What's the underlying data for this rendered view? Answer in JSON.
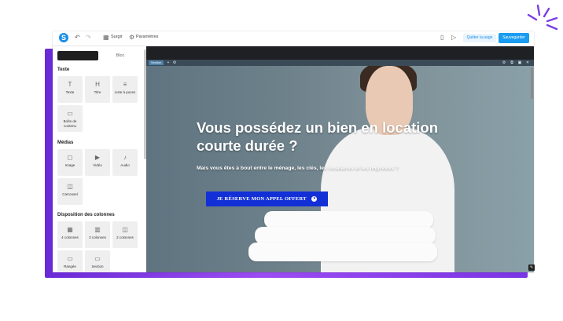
{
  "toolbar": {
    "undo_icon": "undo-icon",
    "redo_icon": "redo-icon",
    "surgir_label": "Surgir",
    "params_label": "Paramètres",
    "quit_label": "Quitter la page",
    "save_label": "Sauvegarder"
  },
  "sidebar": {
    "tab_blocks": "Bloc",
    "sections": {
      "text": "Texte",
      "media": "Médias",
      "columns": "Disposition des colonnes"
    },
    "text_items": [
      {
        "label": "Texte",
        "icon": "T"
      },
      {
        "label": "Titre",
        "icon": "H"
      },
      {
        "label": "Liste à puces",
        "icon": "≡"
      },
      {
        "label": "Boîte de contenu",
        "icon": "▭"
      }
    ],
    "media_items": [
      {
        "label": "Image",
        "icon": "◻"
      },
      {
        "label": "Vidéo",
        "icon": "▶"
      },
      {
        "label": "Audio",
        "icon": "♪"
      },
      {
        "label": "Carrousel",
        "icon": "◫"
      }
    ],
    "column_items": [
      {
        "label": "4 colonnes",
        "icon": "▦"
      },
      {
        "label": "3 colonnes",
        "icon": "▥"
      },
      {
        "label": "2 colonnes",
        "icon": "◫"
      },
      {
        "label": "Rangée",
        "icon": "▭"
      },
      {
        "label": "Section",
        "icon": "▭"
      }
    ]
  },
  "canvas": {
    "section_tag": "Section",
    "hero": {
      "title": "Vous possédez un bien en location courte durée ?",
      "subtitle": "Mais vous êtes à bout entre le ménage, les clés, les locataires et les imprévus ?",
      "cta": "Je réserve mon appel offert"
    }
  },
  "colors": {
    "accent": "#1a9cf0",
    "cta": "#1230d6",
    "frame_gradient": "#7a35e4"
  }
}
